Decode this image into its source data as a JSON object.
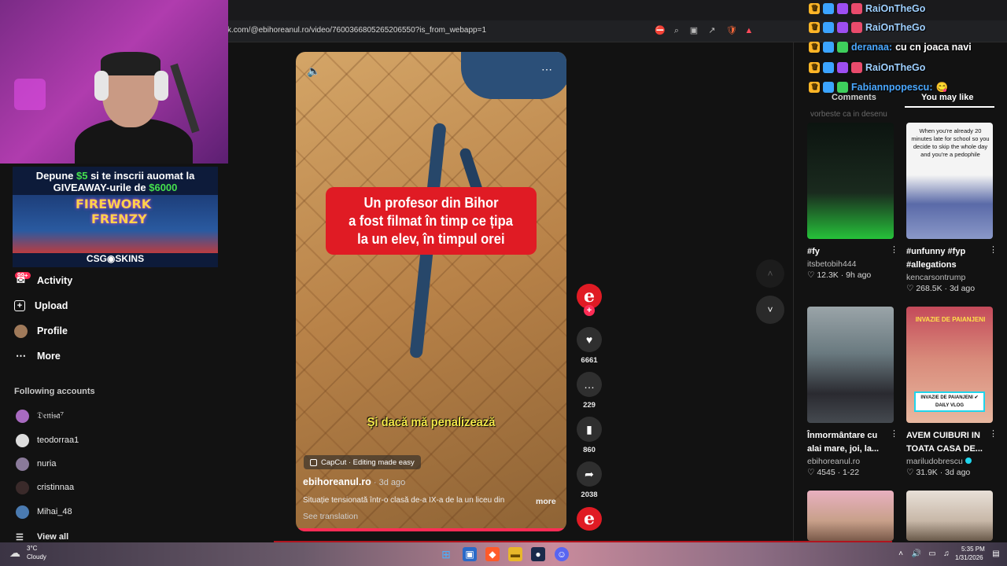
{
  "browser": {
    "url": "k.com/@ebihoreanul.ro/video/7600366805265206550?is_from_webapp=1"
  },
  "ad": {
    "line1_a": "Depune ",
    "line1_amount": "$5",
    "line1_b": " si te inscrii auomat la",
    "line2_a": "GIVEAWAY-urile de ",
    "line2_amount": "$6000",
    "game_title_1": "FIREWORK",
    "game_title_2": "FRENZY",
    "logo": "CSG◉SKINS"
  },
  "sidebar": {
    "badge": "99+",
    "items": [
      {
        "label": "Activity",
        "icon": "inbox-icon"
      },
      {
        "label": "Upload",
        "icon": "plus-square-icon"
      },
      {
        "label": "Profile",
        "icon": "avatar-icon"
      },
      {
        "label": "More",
        "icon": "more-dots-icon"
      }
    ],
    "following_title": "Following accounts",
    "following": [
      {
        "name": "𝔇𝔢𝔫𝔦𝔰𝔞⁷",
        "color": "#a86ac0"
      },
      {
        "name": "teodorraa1",
        "color": "#ddd"
      },
      {
        "name": "nuria",
        "color": "#8a7a9a"
      },
      {
        "name": "cristinnaa",
        "color": "#3a2a2a"
      },
      {
        "name": "Mihai_48",
        "color": "#4a7ab0"
      }
    ],
    "view_all": "View all"
  },
  "video": {
    "headline_lines": [
      "Un profesor din Bihor",
      "a fost filmat în timp ce țipa",
      "la un elev, în timpul orei"
    ],
    "subtitle": "Și dacă mă penalizează",
    "capcut": "CapCut · Editing made easy",
    "author": "ebihoreanul.ro",
    "age": " · 3d ago",
    "description": "Situație tensionată într-o clasă de-a IX-a de la un liceu din",
    "more": "more",
    "see_translation": "See translation"
  },
  "actions": {
    "avatar_letter": "e",
    "follow_plus": "+",
    "likes": "6661",
    "comments": "229",
    "saves": "860",
    "shares": "2038"
  },
  "chat": [
    {
      "user": "RaiOnTheGo",
      "message": "",
      "style": "red"
    },
    {
      "user": "RaiOnTheGo",
      "message": "",
      "style": "red"
    },
    {
      "user": "deranaa:",
      "message": " cu cn joaca navi",
      "style": "blue"
    },
    {
      "user": "RaiOnTheGo",
      "message": "",
      "style": "red"
    },
    {
      "user": "Fabiannpopescu:",
      "message": " 😋",
      "style": "blue"
    }
  ],
  "panel": {
    "tab_comments": "Comments",
    "tab_you_may_like": "You may like",
    "comment_peek": "vorbeste ca in desenu"
  },
  "recommendations": [
    {
      "title": "#fy",
      "author": "itsbetobih444",
      "likes": "12.3K",
      "age": "9h ago",
      "verified": false,
      "thumb_text": "",
      "bg": "#16201a"
    },
    {
      "title": "#unfunny #fyp #allegations",
      "author": "kencarsontrump",
      "likes": "268.5K",
      "age": "3d ago",
      "verified": false,
      "thumb_text": "When you're already 20 minutes late for school so you decide to skip the whole day and you're a pedophile",
      "bg": "#f4f4f4"
    },
    {
      "title": "Înmormântare cu alai mare, joi, la...",
      "author": "ebihoreanul.ro",
      "likes": "4545",
      "age": "1-22",
      "verified": false,
      "thumb_text": "",
      "bg": "#6a7a80"
    },
    {
      "title": "AVEM CUIBURI IN TOATA CASA DE...",
      "author": "mariludobrescu",
      "likes": "31.9K",
      "age": "3d ago",
      "verified": true,
      "thumb_text": "INVAZIE DE PAIANJENI",
      "bg": "#c44a5a"
    },
    {
      "title": "",
      "author": "",
      "likes": "",
      "age": "",
      "verified": false,
      "thumb_text": "",
      "bg": "#c8a08a"
    },
    {
      "title": "",
      "author": "",
      "likes": "",
      "age": "",
      "verified": false,
      "thumb_text": "",
      "bg": "#d8d0c8"
    }
  ],
  "rec_thumb_labels": {
    "spider_badge": "INVAZIE DE PAIANJENI ✔ DAILY VLOG"
  },
  "taskbar": {
    "temp": "3°C",
    "weather": "Cloudy",
    "time": "5:35 PM",
    "date": "1/31/2026"
  }
}
